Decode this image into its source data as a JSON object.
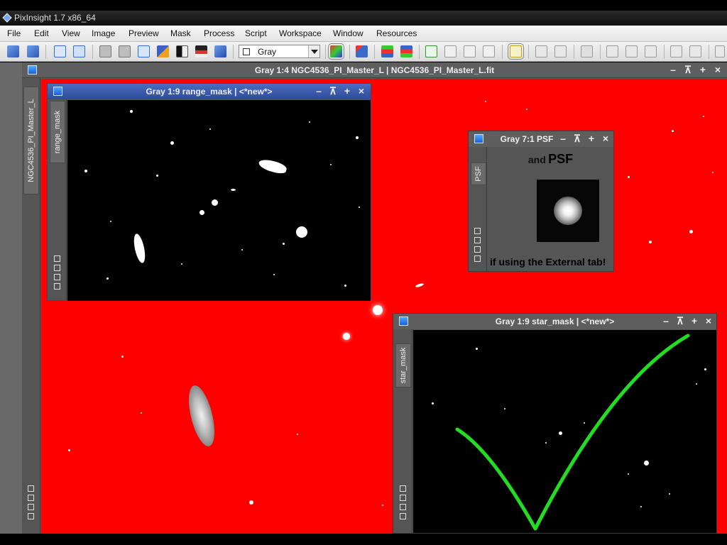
{
  "app": {
    "title": "PixInsight 1.7 x86_64"
  },
  "menu": [
    "File",
    "Edit",
    "View",
    "Image",
    "Preview",
    "Mask",
    "Process",
    "Script",
    "Workspace",
    "Window",
    "Resources"
  ],
  "toolbar": {
    "mode_combo_value": "Gray"
  },
  "main_window": {
    "title": "Gray 1:4 NGC4536_PI_Master_L | NGC4536_PI_Master_L.fit",
    "side_tab": "NGC4536_PI_Master_L",
    "background_color": "#ff0000"
  },
  "range_mask_window": {
    "title": "Gray 1:9 range_mask | <*new*>",
    "side_tab": "range_mask",
    "titlebar_color": "#3a5aa8"
  },
  "psf_window": {
    "title": "Gray 7:1 PSF",
    "side_tab": "PSF",
    "caption_prefix": "and",
    "caption_bold": "PSF",
    "footer_text": "if using the External tab!"
  },
  "star_mask_window": {
    "title": "Gray 1:9 star_mask | <*new*>",
    "side_tab": "star_mask",
    "checkmark_color": "#22dd22"
  },
  "window_controls": {
    "minimize": "–",
    "shade": "⊼",
    "maximize": "+",
    "close": "×"
  }
}
